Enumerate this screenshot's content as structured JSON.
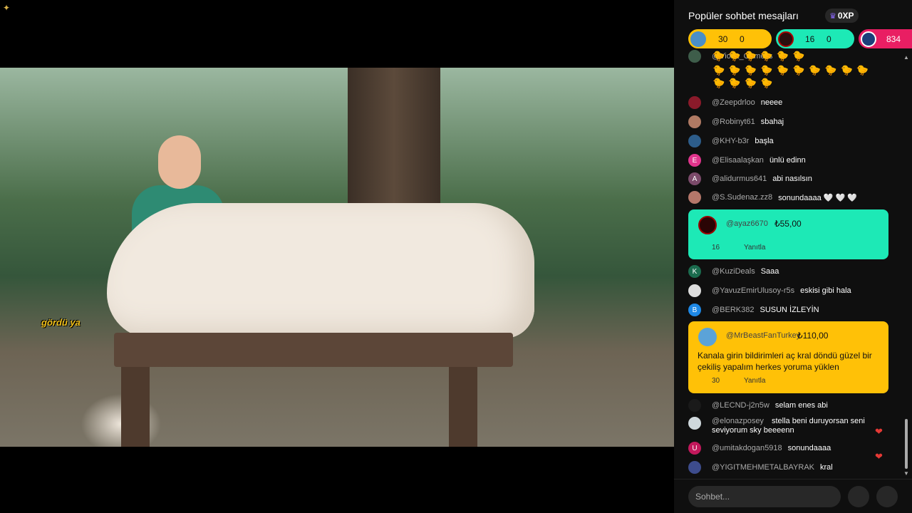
{
  "video": {
    "caption": "gördü ya"
  },
  "chat": {
    "title": "Popüler sohbet mesajları",
    "xp": "0XP",
    "pills": [
      {
        "a": "30",
        "b": "0"
      },
      {
        "a": "16",
        "b": "0"
      },
      {
        "a": "834"
      }
    ],
    "messages": [
      {
        "user": "@Violet_Gamess",
        "text": ""
      },
      {
        "user": "@Zeepdrloo",
        "text": "neeee"
      },
      {
        "user": "@Robinyt61",
        "text": "sbahaj"
      },
      {
        "user": "@KHY-b3r",
        "text": "başla"
      },
      {
        "user": "@Elisaalaşkan",
        "text": "ünlü edinn",
        "initial": "E"
      },
      {
        "user": "@alidurmus641",
        "text": "abi nasılsın",
        "initial": "A"
      },
      {
        "user": "@S.Sudenaz.zz8",
        "text": "sonundaaaa 🤍 🤍 🤍"
      },
      {
        "user": "@KuziDeals",
        "text": "Saaa",
        "initial": "K"
      },
      {
        "user": "@YavuzEmirUlusoy-r5s",
        "text": "eskisi gibi hala"
      },
      {
        "user": "@BERK382",
        "text": "SUSUN İZLEYİN",
        "initial": "B"
      },
      {
        "user": "@LECND-j2n5w",
        "text": "selam enes abi"
      },
      {
        "user": "@elonazposey",
        "text": "stella beni duruyorsan seni seviyorum sky beeeenn"
      },
      {
        "user": "@umitakdogan5918",
        "text": "sonundaaaa",
        "initial": "U"
      },
      {
        "user": "@YIGITMEHMETALBAYRAK",
        "text": "kral"
      }
    ],
    "superchats": [
      {
        "user": "@ayaz6670",
        "amount": "₺55,00",
        "count": "16",
        "reply": "Yanıtla",
        "message": ""
      },
      {
        "user": "@MrBeastFanTurkey",
        "amount": "₺110,00",
        "count": "30",
        "reply": "Yanıtla",
        "message": "Kanala girin bildirimleri aç kral döndü güzel bir çekiliş yapalım herkes yoruma yüklen"
      }
    ],
    "input_placeholder": "Sohbet..."
  }
}
